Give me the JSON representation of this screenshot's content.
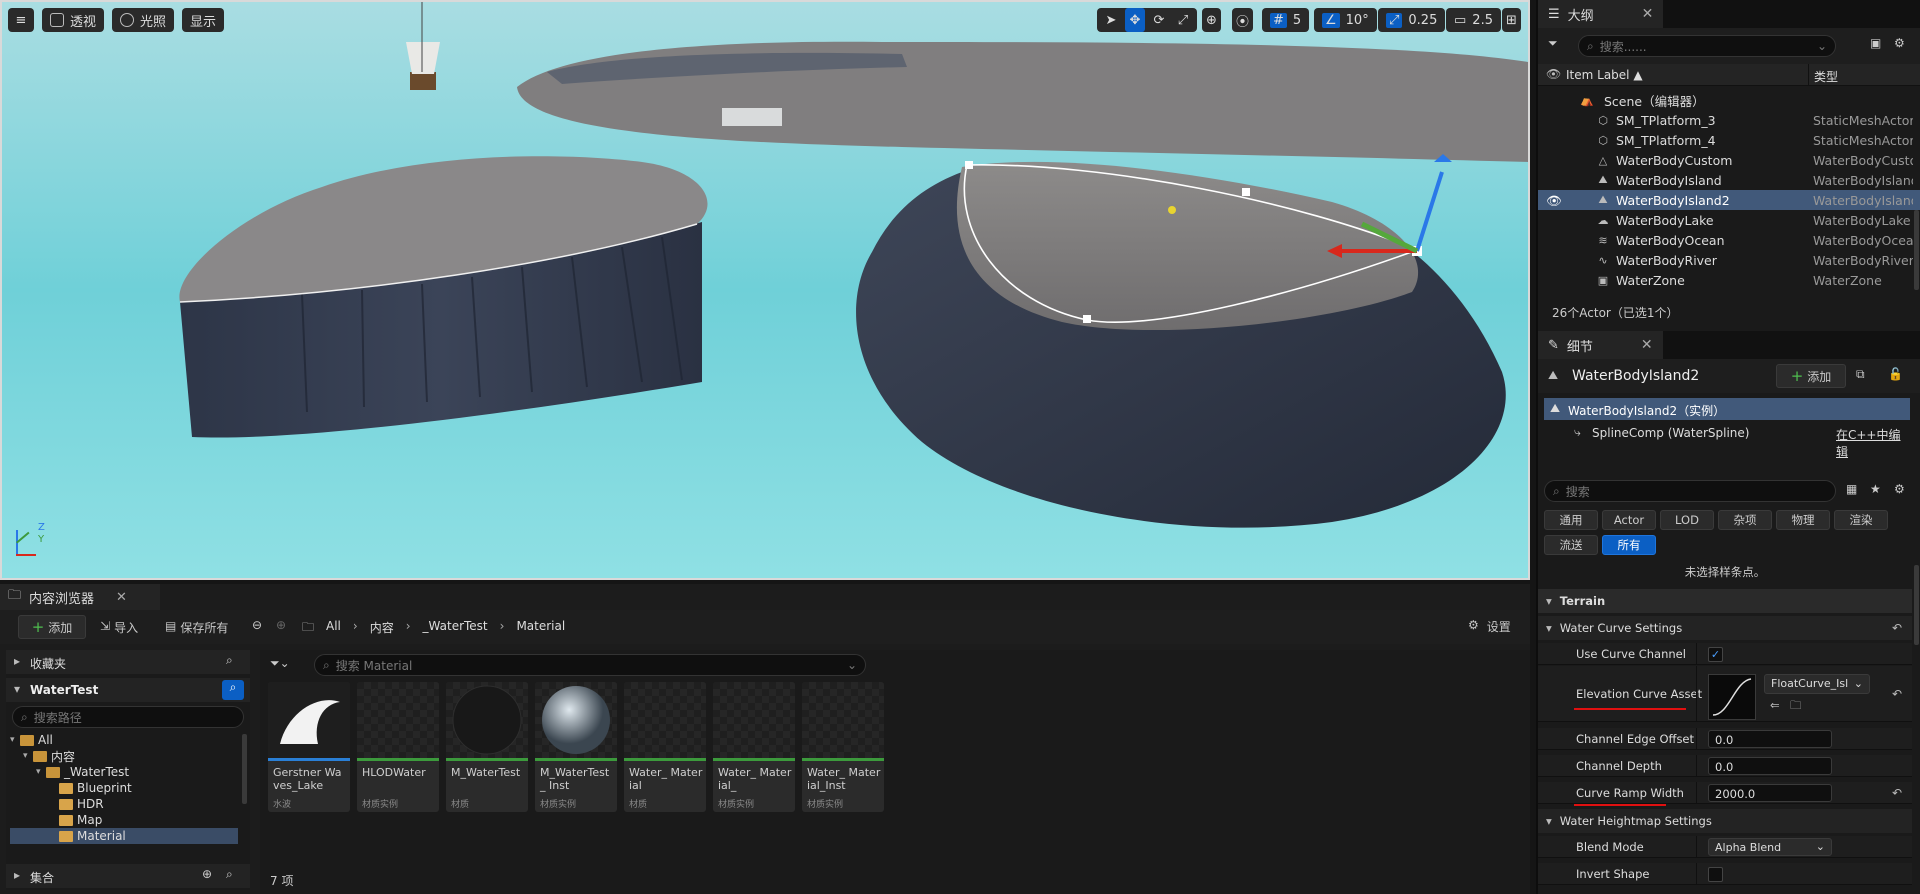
{
  "viewport": {
    "menu_label": "≡",
    "perspective_label": "透视",
    "lighting_label": "光照",
    "show_label": "显示",
    "grid_value": "5",
    "angle_value": "10°",
    "scale_value": "0.25",
    "camera_speed": "2.5",
    "axis_z": "Z",
    "axis_y": "Y"
  },
  "outliner": {
    "tab_title": "大纲",
    "search_placeholder": "搜索......",
    "col_label": "Item Label ▲",
    "col_type": "类型",
    "scene_label": "Scene（编辑器）",
    "rows": [
      {
        "label": "SM_TPlatform_3",
        "type": "StaticMeshActor",
        "icon": "cube-icon"
      },
      {
        "label": "SM_TPlatform_4",
        "type": "StaticMeshActor",
        "icon": "cube-icon"
      },
      {
        "label": "WaterBodyCustom",
        "type": "WaterBodyCustom",
        "icon": "water-icon"
      },
      {
        "label": "WaterBodyIsland",
        "type": "WaterBodyIsland",
        "icon": "island-icon"
      },
      {
        "label": "WaterBodyIsland2",
        "type": "WaterBodyIsland",
        "icon": "island-icon",
        "selected": true
      },
      {
        "label": "WaterBodyLake",
        "type": "WaterBodyLake",
        "icon": "lake-icon"
      },
      {
        "label": "WaterBodyOcean",
        "type": "WaterBodyOcean",
        "icon": "ocean-icon"
      },
      {
        "label": "WaterBodyRiver",
        "type": "WaterBodyRiver",
        "icon": "river-icon"
      },
      {
        "label": "WaterZone",
        "type": "WaterZone",
        "icon": "zone-icon"
      }
    ],
    "status": "26个Actor（已选1个）"
  },
  "details": {
    "tab_title": "细节",
    "actor_name": "WaterBodyIsland2",
    "add_label": "添加",
    "instance_label": "WaterBodyIsland2（实例）",
    "component_label": "SplineComp (WaterSpline)",
    "edit_cpp_label": "在C++中编辑",
    "search_placeholder": "搜索",
    "categories": [
      "通用",
      "Actor",
      "LOD",
      "杂项",
      "物理",
      "渲染",
      "流送",
      "所有"
    ],
    "active_category": "所有",
    "no_selection": "未选择样条点。",
    "section_terrain": "Terrain",
    "water_curve_settings": "Water Curve Settings",
    "use_curve_channel": "Use Curve Channel",
    "elevation_curve_asset": "Elevation Curve Asset",
    "curve_asset_value": "FloatCurve_Isl",
    "channel_edge_offset": "Channel Edge Offset",
    "channel_edge_offset_value": "0.0",
    "channel_depth": "Channel Depth",
    "channel_depth_value": "0.0",
    "curve_ramp_width": "Curve Ramp Width",
    "curve_ramp_width_value": "2000.0",
    "water_heightmap_settings": "Water Heightmap Settings",
    "blend_mode": "Blend Mode",
    "blend_mode_value": "Alpha Blend",
    "invert_shape": "Invert Shape"
  },
  "content_browser": {
    "tab_title": "内容浏览器",
    "add_label": "添加",
    "import_label": "导入",
    "save_all_label": "保存所有",
    "breadcrumb": [
      "All",
      "内容",
      "_WaterTest",
      "Material"
    ],
    "settings_label": "设置",
    "favorites_label": "收藏夹",
    "project_label": "WaterTest",
    "path_search_placeholder": "搜索路径",
    "asset_search_placeholder": "搜索 Material",
    "collections_label": "集合",
    "item_count": "7 项",
    "tree": [
      {
        "label": "All",
        "indent": 0
      },
      {
        "label": "内容",
        "indent": 1
      },
      {
        "label": "_WaterTest",
        "indent": 2
      },
      {
        "label": "Blueprint",
        "indent": 3
      },
      {
        "label": "HDR",
        "indent": 3
      },
      {
        "label": "Map",
        "indent": 3
      },
      {
        "label": "Material",
        "indent": 3,
        "selected": true
      }
    ],
    "assets": [
      {
        "name": "Gerstner Waves_Lake",
        "type": "水波",
        "bar": "#2a7fd6"
      },
      {
        "name": "HLODWater",
        "type": "材质实例",
        "bar": "#3c9a3c"
      },
      {
        "name": "M_WaterTest",
        "type": "材质",
        "bar": "#3c9a3c"
      },
      {
        "name": "M_WaterTest_ Inst",
        "type": "材质实例",
        "bar": "#3c9a3c"
      },
      {
        "name": "Water_ Material",
        "type": "材质",
        "bar": "#3c9a3c"
      },
      {
        "name": "Water_ Material_",
        "type": "材质实例",
        "bar": "#3c9a3c"
      },
      {
        "name": "Water_ Material_Inst",
        "type": "材质实例",
        "bar": "#3c9a3c"
      }
    ]
  }
}
